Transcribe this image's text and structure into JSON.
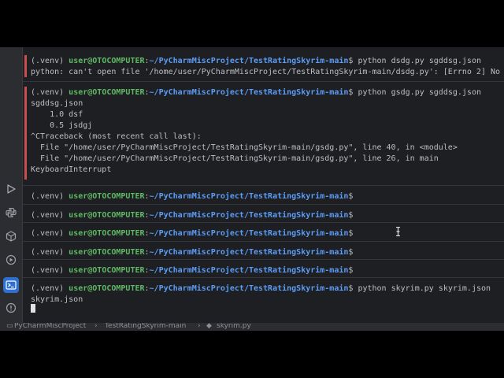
{
  "prompt": {
    "venv": "(.venv) ",
    "user": "user@OTOCOMPUTER",
    "sep": ":",
    "path": "~/PyCharmMiscProject/TestRatingSkyrim-main",
    "dollar": "$"
  },
  "blocks": [
    {
      "command": " python dsdg.py sgddsg.json",
      "status": "error",
      "output": [
        "python: can't open file '/home/user/PyCharmMiscProject/TestRatingSkyrim-main/dsdg.py': [Errno 2] No"
      ]
    },
    {
      "command": " python gsdg.py sgddsg.json",
      "status": "error",
      "output": [
        "sgddsg.json",
        "    1.0 dsf",
        "    0.5 jsdgj",
        "^CTraceback (most recent call last):",
        "  File \"/home/user/PyCharmMiscProject/TestRatingSkyrim-main/gsdg.py\", line 40, in <module>",
        "  File \"/home/user/PyCharmMiscProject/TestRatingSkyrim-main/gsdg.py\", line 26, in main",
        "KeyboardInterrupt"
      ]
    },
    {
      "command": "",
      "status": "ok",
      "output": []
    },
    {
      "command": "",
      "status": "ok",
      "output": []
    },
    {
      "command": "",
      "status": "ok",
      "output": []
    },
    {
      "command": "",
      "status": "ok",
      "output": []
    },
    {
      "command": "",
      "status": "ok",
      "output": []
    },
    {
      "command": " python skyrim.py skyrim.json",
      "status": "running",
      "output": [
        "skyrim.json"
      ]
    }
  ],
  "sidebar": {
    "icons": [
      "run-icon",
      "python-console-icon",
      "python-packages-icon",
      "services-icon",
      "terminal-icon",
      "problems-icon"
    ],
    "active": "terminal-icon"
  },
  "breadcrumb": {
    "project": "PyCharmMiscProject",
    "folder": "TestRatingSkyrim-main",
    "file": "skyrim.py"
  },
  "colors": {
    "background": "#1e1f22",
    "user": "#5fb865",
    "path": "#5c9cf5",
    "error_bar": "#c94f4f",
    "active_tool": "#2f6fd0"
  }
}
